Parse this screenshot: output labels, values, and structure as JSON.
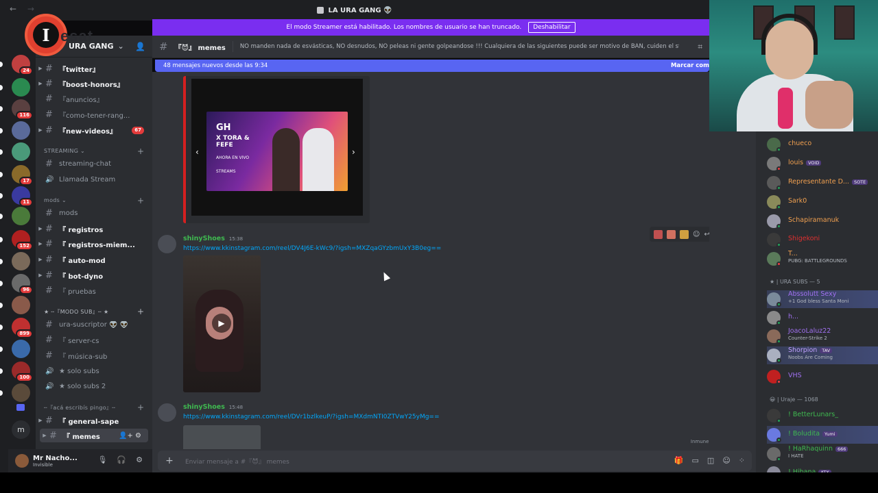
{
  "window": {
    "title": "LA URA GANG 👽",
    "back": "←",
    "forward": "→"
  },
  "logo_text": "I",
  "logo_wordmark": "esat",
  "banner": {
    "text": "El modo Streamer está habilitado. Los nombres de usuario se han truncado.",
    "button": "Deshabilitar"
  },
  "servers": [
    {
      "badge": "24"
    },
    {
      "badge": ""
    },
    {
      "badge": "116"
    },
    {
      "badge": ""
    },
    {
      "badge": ""
    },
    {
      "badge": "17"
    },
    {
      "badge": "11"
    },
    {
      "badge": ""
    },
    {
      "badge": "152"
    },
    {
      "badge": ""
    },
    {
      "badge": "96"
    },
    {
      "badge": ""
    },
    {
      "badge": "899"
    },
    {
      "badge": ""
    },
    {
      "badge": "100"
    },
    {
      "badge": ""
    }
  ],
  "server_misc": {
    "m": "m"
  },
  "guild": {
    "name": "URA GANG"
  },
  "channels": {
    "twitter": "『twitter』",
    "boost": "『boost-honors』",
    "anuncios": "『anuncios』",
    "como": "『como-tener-rang...",
    "videos": "『new-videos』",
    "videos_badge": "67",
    "cat_streaming": "STREAMING",
    "streaming_chat": "streaming-chat",
    "llamada": "Llamada Stream",
    "cat_mods": "mods",
    "mods": "mods",
    "registros": "『 registros",
    "registros_miem": "『 registros-miem...",
    "automod": "『 auto-mod",
    "botdyno": "『 bot-dyno",
    "pruebas": "『 pruebas",
    "cat_sub": "★ ╌『MODO SUB』╌ ★",
    "ura_suscriptor": "ura-suscriptor 👽 👽",
    "server_cs": "『 server-cs",
    "musica_sub": "『 música-sub",
    "solo_subs": "★ solo subs",
    "solo_subs2": "★ solo subs 2",
    "cat_pingo": "╌『acá escribís pingo』╌",
    "general_sape": "『 general-sape",
    "memes": "『 memes"
  },
  "user": {
    "name": "Mr Nacho...",
    "status": "Invisible"
  },
  "header": {
    "channel": "『😈』 memes",
    "topic": "NO manden nada de esvásticas, NO desnudos, NO peleas ni gente golpeandose !!! Cualquiera de las siguientes puede ser motivo de BAN, cuiden el stream!"
  },
  "newbar": {
    "text": "48 mensajes nuevos desde las 9:34",
    "mark": "Marcar com"
  },
  "embed": {
    "gh": "GH",
    "sub": "X TORA & FEFE",
    "live": "AHORA EN VIVO",
    "brand": "STREAMS"
  },
  "messages": [
    {
      "author": "shinyShoes",
      "time": "15:38",
      "link": "https://www.kkinstagram.com/reel/DV4J6E-kWc9/?igsh=MXZqaGYzbmUxY3B0eg=="
    },
    {
      "author": "shinyShoes",
      "time": "15:48",
      "link": "https://www.kkinstagram.com/reel/DVr1bzlkeuP/?igsh=MXdmNTI0ZTVwY25yMg=="
    }
  ],
  "immune": "Inmune al modo pausado",
  "composer": {
    "placeholder": "Enviar mensaje a #『😈』 memes"
  },
  "members": {
    "list": [
      {
        "name": "chueco",
        "color": "#f0a050",
        "sub": "",
        "tag": ""
      },
      {
        "name": "louis",
        "color": "#f0a050",
        "sub": "",
        "tag": "VOID"
      },
      {
        "name": "Representante D...",
        "color": "#f0a050",
        "sub": "",
        "tag": "SOTE"
      },
      {
        "name": "Sark0",
        "color": "#f0a050",
        "sub": "",
        "tag": ""
      },
      {
        "name": "Schapiramanuk",
        "color": "#f0a050",
        "sub": "",
        "tag": ""
      },
      {
        "name": "Shigekoni",
        "color": "#e03030",
        "sub": "",
        "tag": ""
      },
      {
        "name": "T...",
        "color": "#f0a050",
        "sub": "PUBG: BATTLEGROUNDS",
        "tag": ""
      }
    ],
    "head_subs": "★ | URA SUBS — 5",
    "subs": [
      {
        "name": "Abssolutt Sexy",
        "color": "#a070f0",
        "sub": "+1 God bless Santa Moni",
        "tag": ""
      },
      {
        "name": "h...",
        "color": "#a070f0",
        "sub": "",
        "tag": ""
      },
      {
        "name": "JoacoLaluz22",
        "color": "#a070f0",
        "sub": "Counter-Strike 2",
        "tag": ""
      },
      {
        "name": "Shorpion",
        "color": "#c0a0ff",
        "sub": "Noobs Are Coming",
        "tag": "TAV"
      },
      {
        "name": "VHS",
        "color": "#a070f0",
        "sub": "",
        "tag": ""
      }
    ],
    "head_uraje": "😀 | Uraje — 1068",
    "uraje": [
      {
        "name": "! BetterLunars_",
        "color": "#3fb950",
        "sub": "",
        "tag": ""
      },
      {
        "name": "! Boludita",
        "color": "#3fb950",
        "sub": "",
        "tag": "Yumi"
      },
      {
        "name": "! HaRhaquinn",
        "color": "#3fb950",
        "sub": "I HATE",
        "tag": "666"
      },
      {
        "name": "! Hibana",
        "color": "#3fb950",
        "sub": "",
        "tag": "ATX"
      }
    ]
  }
}
